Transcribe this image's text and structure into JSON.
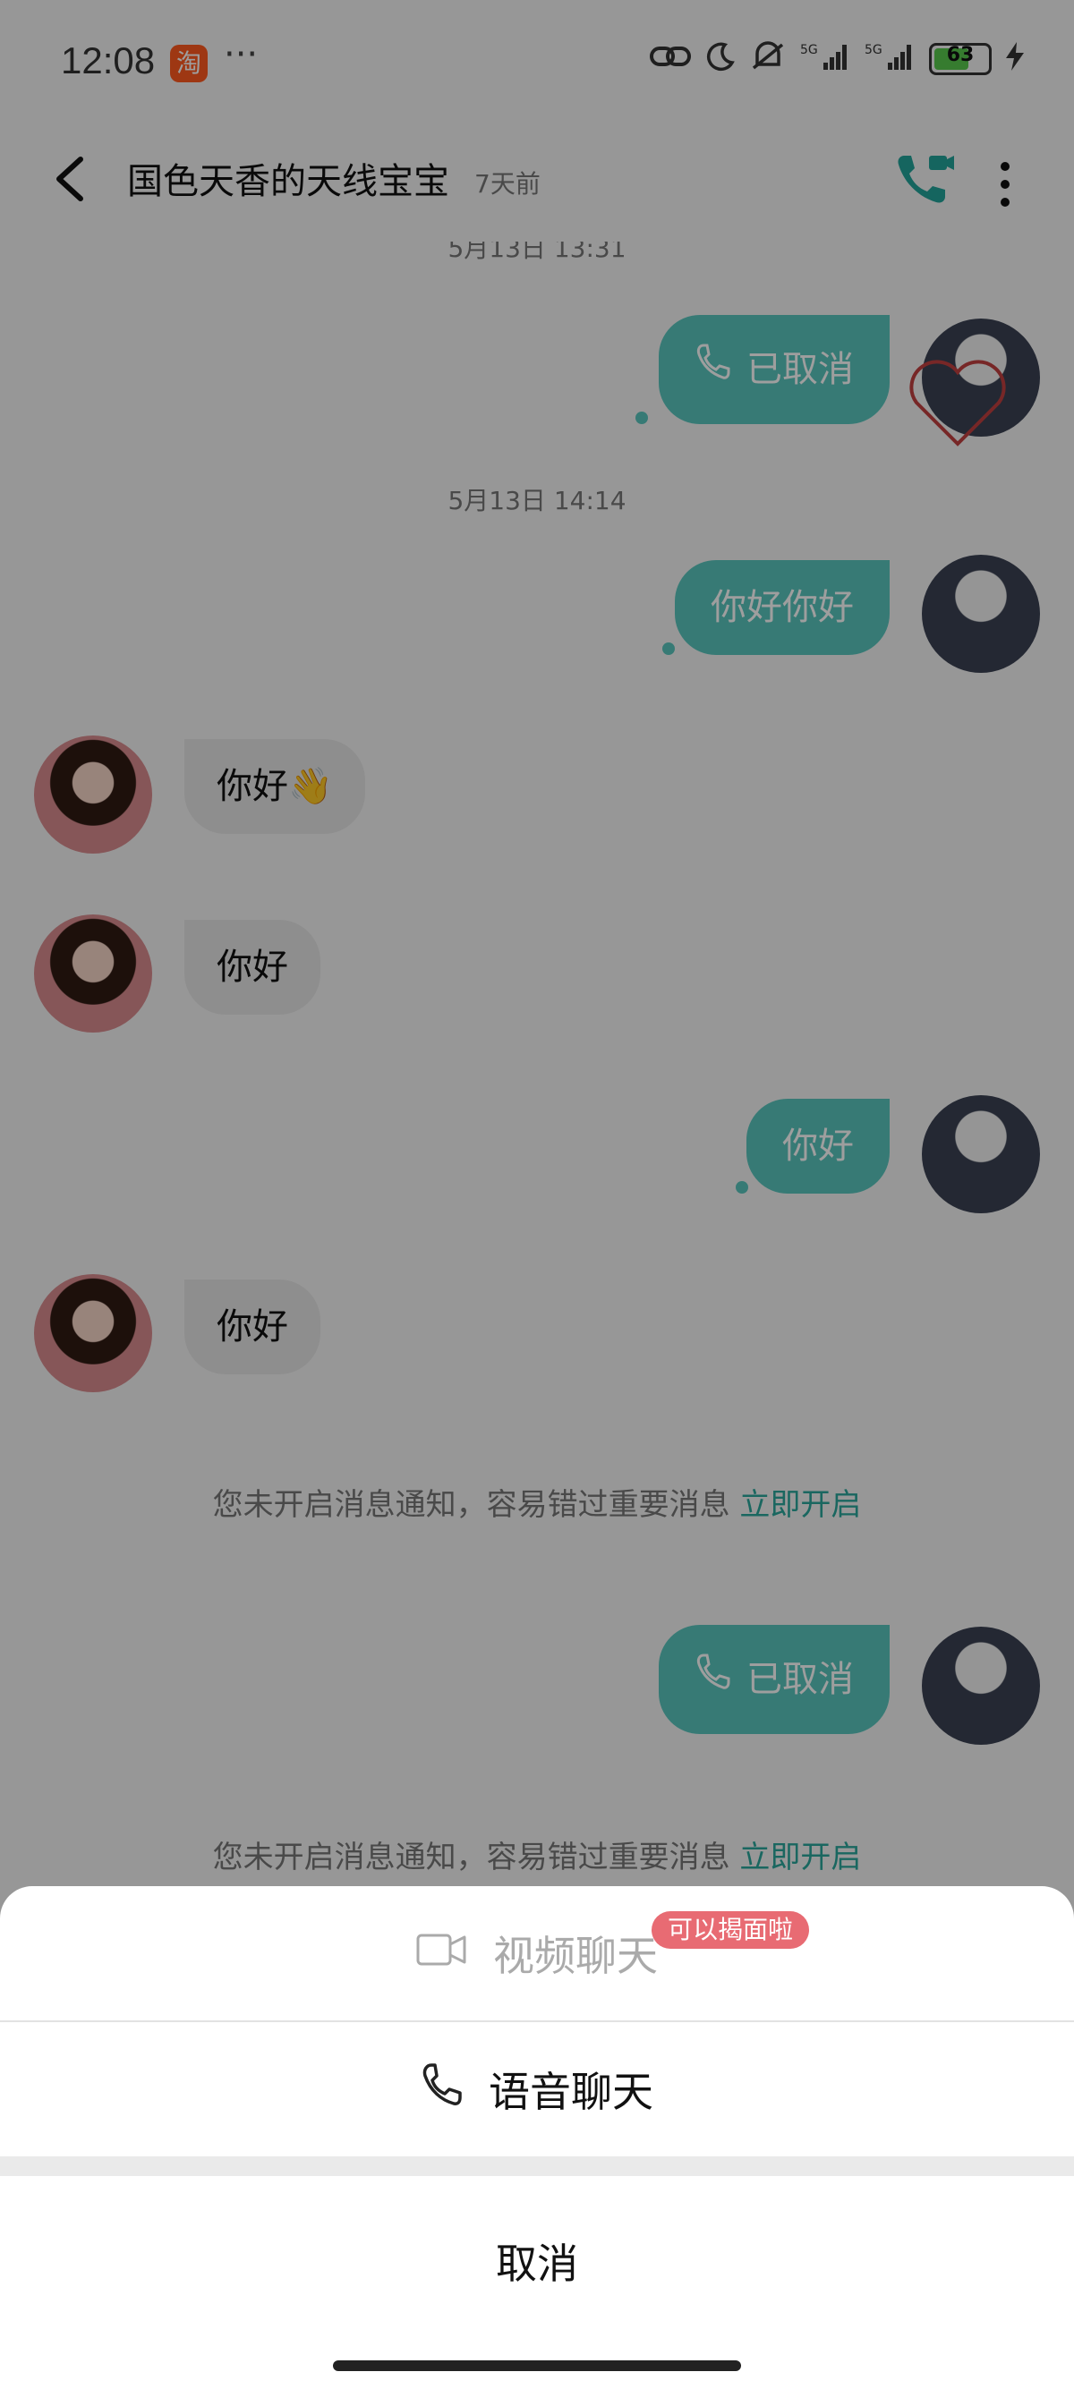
{
  "status_bar": {
    "time": "12:08",
    "app_icon_label": "淘",
    "more": "···",
    "battery": "63",
    "icons": [
      "link-icon",
      "moon-icon",
      "mute-icon",
      "signal-5g-icon",
      "signal-5g-icon",
      "battery-icon",
      "charging-icon"
    ]
  },
  "header": {
    "title": "国色天香的天线宝宝",
    "last_seen": "7天前"
  },
  "chat": {
    "partial_timestamp": "5月13日 13:31",
    "timestamp": "5月13日 14:14",
    "messages": {
      "cancel1": "已取消",
      "out1": "你好你好",
      "in1": "你好👋",
      "in2": "你好",
      "out2": "你好",
      "in3": "你好",
      "cancel2": "已取消"
    },
    "notice": {
      "text": "您未开启消息通知，容易错过重要消息 ",
      "link": "立即开启"
    }
  },
  "sheet": {
    "video_label": "视频聊天",
    "video_badge": "可以揭面啦",
    "voice_label": "语音聊天",
    "cancel_label": "取消"
  },
  "colors": {
    "accent": "#59c6bd",
    "link": "#2aa79b",
    "badge": "#e86b73"
  }
}
